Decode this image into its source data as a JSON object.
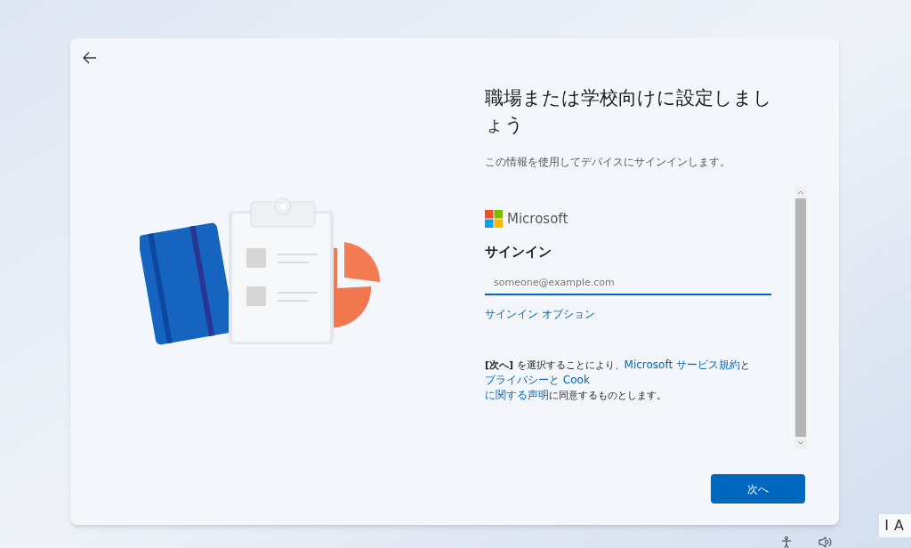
{
  "header": {
    "title": "職場または学校向けに設定しましょう",
    "subtitle": "この情報を使用してデバイスにサインインします。"
  },
  "signin": {
    "brand": "Microsoft",
    "heading": "サインイン",
    "email": {
      "placeholder": "someone@example.com"
    },
    "options_link": "サインイン オプション"
  },
  "terms": {
    "lines": [
      [
        {
          "kind": "text",
          "text": "**[次へ]** を選択することにより、"
        },
        {
          "kind": "link",
          "text": "Microsoft サービス規約"
        },
        {
          "kind": "text",
          "text": "と"
        },
        {
          "kind": "link",
          "text": "プライバシーと Cook"
        }
      ],
      [
        {
          "kind": "link",
          "text": "に関する声明"
        },
        {
          "kind": "text",
          "text": "に同意するものとします。"
        }
      ]
    ]
  },
  "next_button": "次へ",
  "taskbar": {
    "ime": [
      "I",
      "A"
    ]
  }
}
